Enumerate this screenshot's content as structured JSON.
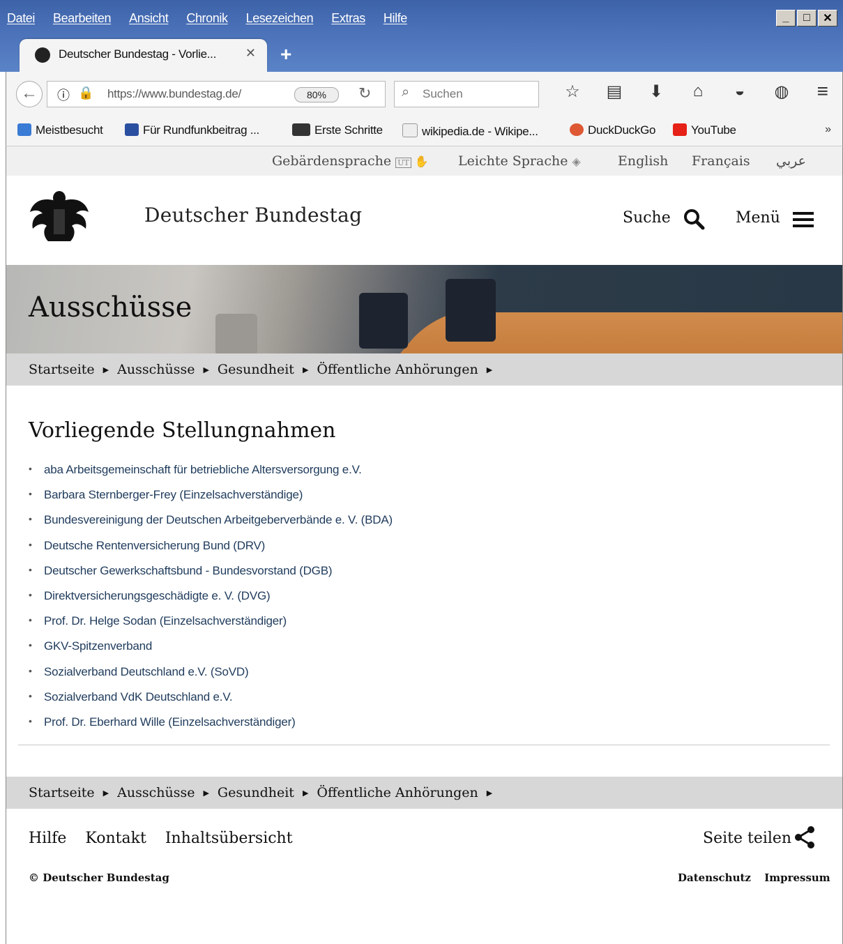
{
  "menubar": [
    "Datei",
    "Bearbeiten",
    "Ansicht",
    "Chronik",
    "Lesezeichen",
    "Extras",
    "Hilfe"
  ],
  "window_buttons": [
    "_",
    "□",
    "✕"
  ],
  "tab": {
    "title": "Deutscher Bundestag - Vorlie...",
    "close": "✕"
  },
  "new_tab": "+",
  "navbar": {
    "url": "https://www.bundestag.de/",
    "zoom": "80%",
    "search_placeholder": "Suchen"
  },
  "bookmarks": [
    "Meistbesucht",
    "Für Rundfunkbeitrag ...",
    "Erste Schritte",
    "wikipedia.de - Wikipe...",
    "DuckDuckGo",
    "YouTube"
  ],
  "bookmark_overflow": "»",
  "languages": {
    "sign": "Gebärdensprache",
    "sign_badge": "UT",
    "easy": "Leichte Sprache",
    "english": "English",
    "french": "Français",
    "arabic": "عربي"
  },
  "header": {
    "site_name": "Deutscher Bundestag",
    "search_label": "Suche",
    "menu_label": "Menü"
  },
  "banner": {
    "title": "Ausschüsse"
  },
  "breadcrumb": [
    "Startseite",
    "Ausschüsse",
    "Gesundheit",
    "Öffentliche Anhörungen"
  ],
  "main": {
    "heading": "Vorliegende Stellungnahmen",
    "items": [
      "aba Arbeitsgemeinschaft für betriebliche Altersversorgung e.V.",
      "Barbara Sternberger-Frey (Einzelsachverständige)",
      "Bundesvereinigung der Deutschen Arbeitgeberverbände e. V. (BDA)",
      "Deutsche Rentenversicherung Bund (DRV)",
      "Deutscher Gewerkschaftsbund - Bundesvorstand (DGB)",
      "Direktversicherungsgeschädigte e. V. (DVG)",
      "Prof. Dr. Helge Sodan (Einzelsachverständiger)",
      "GKV-Spitzenverband",
      "Sozialverband Deutschland e.V. (SoVD)",
      "Sozialverband VdK Deutschland e.V.",
      "Prof. Dr. Eberhard Wille (Einzelsachverständiger)"
    ]
  },
  "footer": {
    "links": [
      "Hilfe",
      "Kontakt",
      "Inhaltsübersicht"
    ],
    "share": "Seite teilen",
    "copyright": "© Deutscher Bundestag",
    "legal": [
      "Datenschutz",
      "Impressum"
    ]
  },
  "colors": {
    "link": "#1f3b5c",
    "crumb_bg": "#d7d7d7",
    "titlebar": "#4a71b8"
  }
}
